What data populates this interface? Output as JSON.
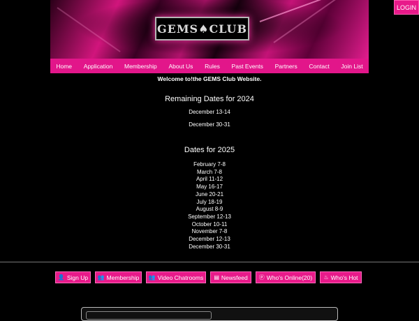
{
  "header": {
    "login_label": "LOGIN",
    "logo_text": "GEMS♠CLUB"
  },
  "nav": {
    "items": [
      "Home",
      "Application",
      "Membership",
      "About Us",
      "Rules",
      "Past Events",
      "Partners",
      "Contact",
      "Join List"
    ]
  },
  "main": {
    "welcome": "Welcome to!the GEMS Club Website.",
    "remaining_title": "Remaining Dates for 2024",
    "remaining_dates": [
      "December 13-14",
      "December 30-31"
    ],
    "dates_title": "Dates for 2025",
    "dates_2025": [
      "February 7-8",
      "March 7-8",
      "April 11-12",
      "May 16-17",
      "June 20-21",
      "July 18-19",
      "August 8-9",
      "September 12-13",
      "October 10-11",
      "November 7-8",
      "December 12-13",
      "December 30-31"
    ]
  },
  "footer": {
    "buttons": [
      {
        "label": "Sign Up",
        "icon": "user-icon",
        "glyph": "👤"
      },
      {
        "label": "Membership",
        "icon": "user-plus-icon",
        "glyph": "👥"
      },
      {
        "label": "Video Chatrooms",
        "icon": "users-icon",
        "glyph": "👥"
      },
      {
        "label": "Newsfeed",
        "icon": "newspaper-icon",
        "glyph": "▤"
      },
      {
        "label": "Who's Online(20)",
        "icon": "pinterest-icon",
        "glyph": "ⓟ"
      },
      {
        "label": "Who's Hot",
        "icon": "fire-icon",
        "glyph": "♨"
      }
    ]
  },
  "colors": {
    "accent": "#e2168a",
    "background": "#000000"
  }
}
